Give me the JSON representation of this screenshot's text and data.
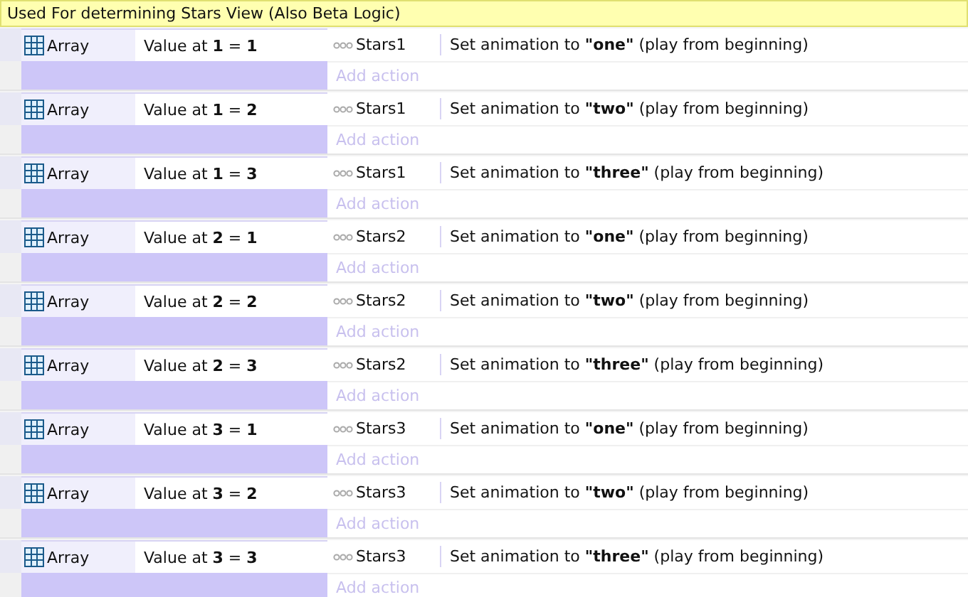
{
  "group": {
    "title": "Used For determining Stars View (Also Beta Logic)"
  },
  "events": [
    {
      "condition": {
        "object": "Array",
        "text": "Value at **1** = **1**"
      },
      "action": {
        "object": "Stars1",
        "text": "Set animation to **\"one\"** (play from beginning)"
      },
      "add_action": "Add action"
    },
    {
      "condition": {
        "object": "Array",
        "text": "Value at **1** = **2**"
      },
      "action": {
        "object": "Stars1",
        "text": "Set animation to **\"two\"** (play from beginning)"
      },
      "add_action": "Add action"
    },
    {
      "condition": {
        "object": "Array",
        "text": "Value at **1** = **3**"
      },
      "action": {
        "object": "Stars1",
        "text": "Set animation to **\"three\"** (play from beginning)"
      },
      "add_action": "Add action"
    },
    {
      "condition": {
        "object": "Array",
        "text": "Value at **2** = **1**"
      },
      "action": {
        "object": "Stars2",
        "text": "Set animation to **\"one\"** (play from beginning)"
      },
      "add_action": "Add action"
    },
    {
      "condition": {
        "object": "Array",
        "text": "Value at **2** = **2**"
      },
      "action": {
        "object": "Stars2",
        "text": "Set animation to **\"two\"** (play from beginning)"
      },
      "add_action": "Add action"
    },
    {
      "condition": {
        "object": "Array",
        "text": "Value at **2** = **3**"
      },
      "action": {
        "object": "Stars2",
        "text": "Set animation to **\"three\"** (play from beginning)"
      },
      "add_action": "Add action"
    },
    {
      "condition": {
        "object": "Array",
        "text": "Value at **3** = **1**"
      },
      "action": {
        "object": "Stars3",
        "text": "Set animation to **\"one\"** (play from beginning)"
      },
      "add_action": "Add action"
    },
    {
      "condition": {
        "object": "Array",
        "text": "Value at **3** = **2**"
      },
      "action": {
        "object": "Stars3",
        "text": "Set animation to **\"two\"** (play from beginning)"
      },
      "add_action": "Add action"
    },
    {
      "condition": {
        "object": "Array",
        "text": "Value at **3** = **3**"
      },
      "action": {
        "object": "Stars3",
        "text": "Set animation to **\"three\"** (play from beginning)"
      },
      "add_action": "Add action"
    }
  ]
}
